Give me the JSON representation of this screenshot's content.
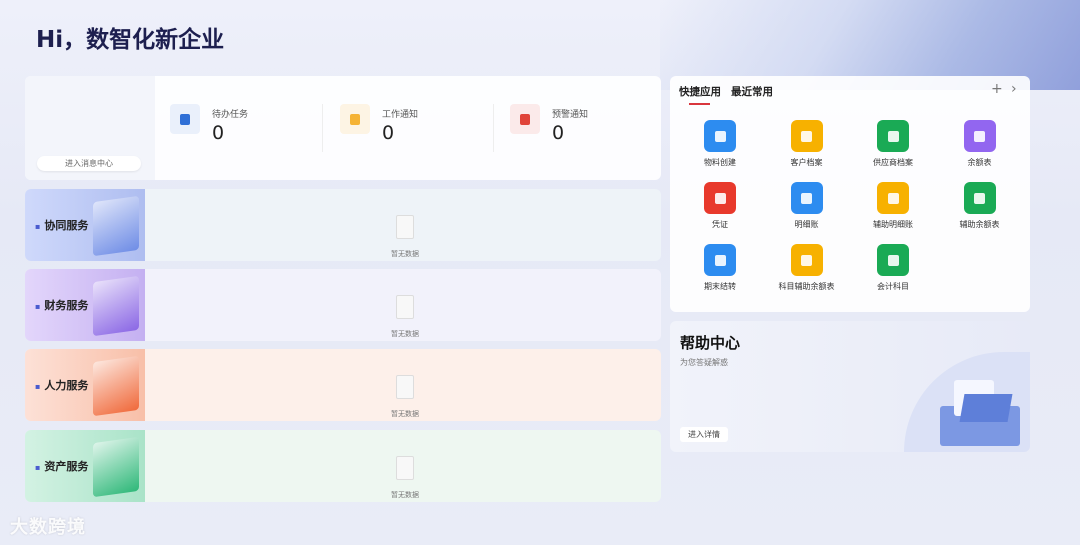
{
  "header": {
    "title": "Hi，数智化新企业"
  },
  "messages": {
    "enter_label": "进入消息中心",
    "stats": [
      {
        "label": "待办任务",
        "value": "0",
        "icon": "task-icon",
        "color": "#2f6fd6",
        "bg": "#eaf0fb"
      },
      {
        "label": "工作通知",
        "value": "0",
        "icon": "notice-icon",
        "color": "#f5b335",
        "bg": "#fdf4e4"
      },
      {
        "label": "预警通知",
        "value": "0",
        "icon": "alarm-icon",
        "color": "#e0443a",
        "bg": "#fbeaea"
      }
    ]
  },
  "services": [
    {
      "label": "协同服务",
      "empty": "暂无数据",
      "bg": "linear-gradient(90deg,#cfd9fb,#aebdf0)",
      "art": "#6f8de6",
      "panel": "#eef3f8"
    },
    {
      "label": "财务服务",
      "empty": "暂无数据",
      "bg": "linear-gradient(90deg,#e3d6fb,#c4b0f1)",
      "art": "#8b68e5",
      "panel": "#f2f2fb"
    },
    {
      "label": "人力服务",
      "empty": "暂无数据",
      "bg": "linear-gradient(90deg,#fde1d7,#f8bfa8)",
      "art": "#f06a3c",
      "panel": "#fdf0ea"
    },
    {
      "label": "资产服务",
      "empty": "暂无数据",
      "bg": "linear-gradient(90deg,#d3f2e3,#a9e3c8)",
      "art": "#2fb879",
      "panel": "#eef7f1"
    }
  ],
  "quick": {
    "tabs": [
      "快捷应用",
      "最近常用"
    ],
    "add": "+",
    "next": "›",
    "apps": [
      {
        "label": "物料创建",
        "color": "#2d8cf0"
      },
      {
        "label": "客户档案",
        "color": "#f7b100"
      },
      {
        "label": "供应商档案",
        "color": "#1aaa55"
      },
      {
        "label": "余额表",
        "color": "#9266f0"
      },
      {
        "label": "凭证",
        "color": "#e8392c"
      },
      {
        "label": "明细账",
        "color": "#2d8cf0"
      },
      {
        "label": "辅助明细账",
        "color": "#f7b100"
      },
      {
        "label": "辅助余额表",
        "color": "#1aaa55"
      },
      {
        "label": "期末结转",
        "color": "#2d8cf0"
      },
      {
        "label": "科目辅助余额表",
        "color": "#f7b100"
      },
      {
        "label": "会计科目",
        "color": "#1aaa55"
      }
    ]
  },
  "help": {
    "title": "帮助中心",
    "subtitle": "为您答疑解惑",
    "button": "进入详情"
  },
  "watermark": "大数跨境"
}
